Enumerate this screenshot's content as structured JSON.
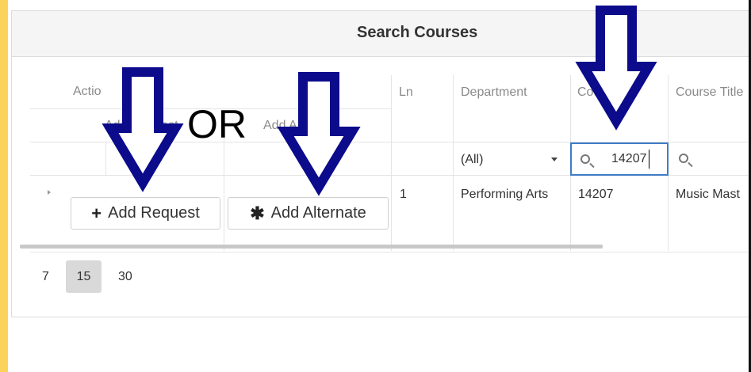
{
  "panel": {
    "title": "Search Courses"
  },
  "columns": {
    "action": "Actio",
    "add_request": "Add Request",
    "add_alternate": "Add Alternate",
    "ln": "Ln",
    "department": "Department",
    "course_id": "Course ID",
    "course_title": "Course Title"
  },
  "filters": {
    "department": "(All)",
    "course_id": "14207"
  },
  "row": {
    "ln": "1",
    "department": "Performing Arts",
    "course_id": "14207",
    "course_title": "Music Mast",
    "add_request_label": "Add Request",
    "add_alternate_label": "Add Alternate",
    "add_request_icon": "plus-icon",
    "add_alternate_icon": "asterisk-icon"
  },
  "pager": {
    "sizes": [
      "7",
      "15",
      "30"
    ],
    "selected": "15"
  },
  "annotation": {
    "or_label": "OR",
    "arrow_color": "#0b0b8c"
  }
}
